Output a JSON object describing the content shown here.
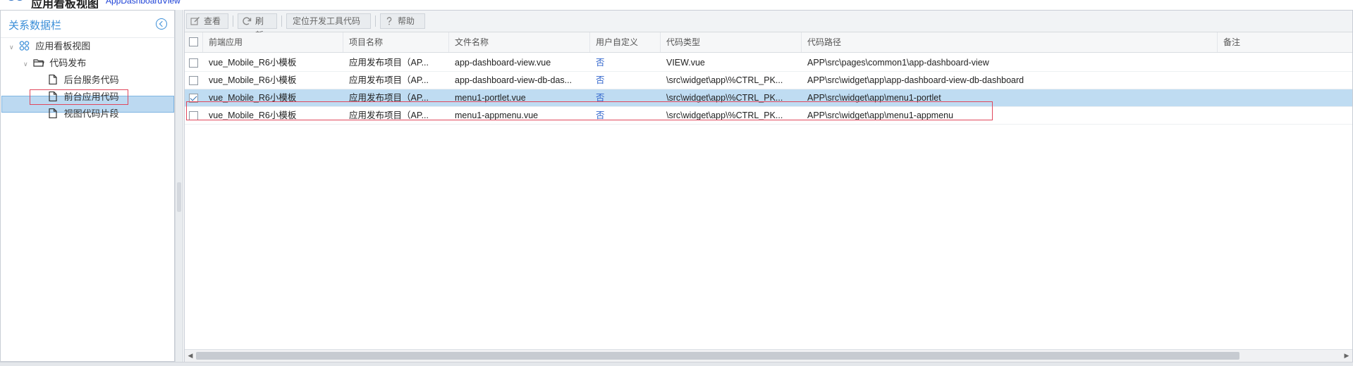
{
  "app": {
    "title": "应用看板视图",
    "subtitle": "AppDashboardView"
  },
  "left_panel": {
    "title": "关系数据栏",
    "tree": [
      {
        "label": "应用看板视图",
        "icon": "app-grid-icon"
      },
      {
        "label": "代码发布",
        "icon": "folder-open-icon"
      },
      {
        "label": "后台服务代码",
        "icon": "file-icon"
      },
      {
        "label": "前台应用代码",
        "icon": "file-icon",
        "selected": true
      },
      {
        "label": "视图代码片段",
        "icon": "file-icon"
      }
    ]
  },
  "toolbar": {
    "view": "查看",
    "refresh": "刷新",
    "locate": "定位开发工具代码",
    "help": "帮助"
  },
  "grid": {
    "columns": [
      "前端应用",
      "项目名称",
      "文件名称",
      "用户自定义",
      "代码类型",
      "代码路径",
      "备注"
    ],
    "rows": [
      {
        "app": "vue_Mobile_R6小模板",
        "project": "应用发布项目（AP...",
        "file": "app-dashboard-view.vue",
        "custom": "否",
        "type": "VIEW.vue",
        "path": "APP\\src\\pages\\common1\\app-dashboard-view",
        "note": "",
        "checked": false
      },
      {
        "app": "vue_Mobile_R6小模板",
        "project": "应用发布项目（AP...",
        "file": "app-dashboard-view-db-das...",
        "custom": "否",
        "type": "\\src\\widget\\app\\%CTRL_PK...",
        "path": "APP\\src\\widget\\app\\app-dashboard-view-db-dashboard",
        "note": "",
        "checked": false
      },
      {
        "app": "vue_Mobile_R6小模板",
        "project": "应用发布项目（AP...",
        "file": "menu1-portlet.vue",
        "custom": "否",
        "type": "\\src\\widget\\app\\%CTRL_PK...",
        "path": "APP\\src\\widget\\app\\menu1-portlet",
        "note": "",
        "checked": true
      },
      {
        "app": "vue_Mobile_R6小模板",
        "project": "应用发布项目（AP...",
        "file": "menu1-appmenu.vue",
        "custom": "否",
        "type": "\\src\\widget\\app\\%CTRL_PK...",
        "path": "APP\\src\\widget\\app\\menu1-appmenu",
        "note": "",
        "checked": false
      }
    ]
  },
  "colors": {
    "accent": "#3c8fd8",
    "selection": "#bfdcf2",
    "highlight_box": "#e0475c",
    "link": "#3366cc"
  }
}
